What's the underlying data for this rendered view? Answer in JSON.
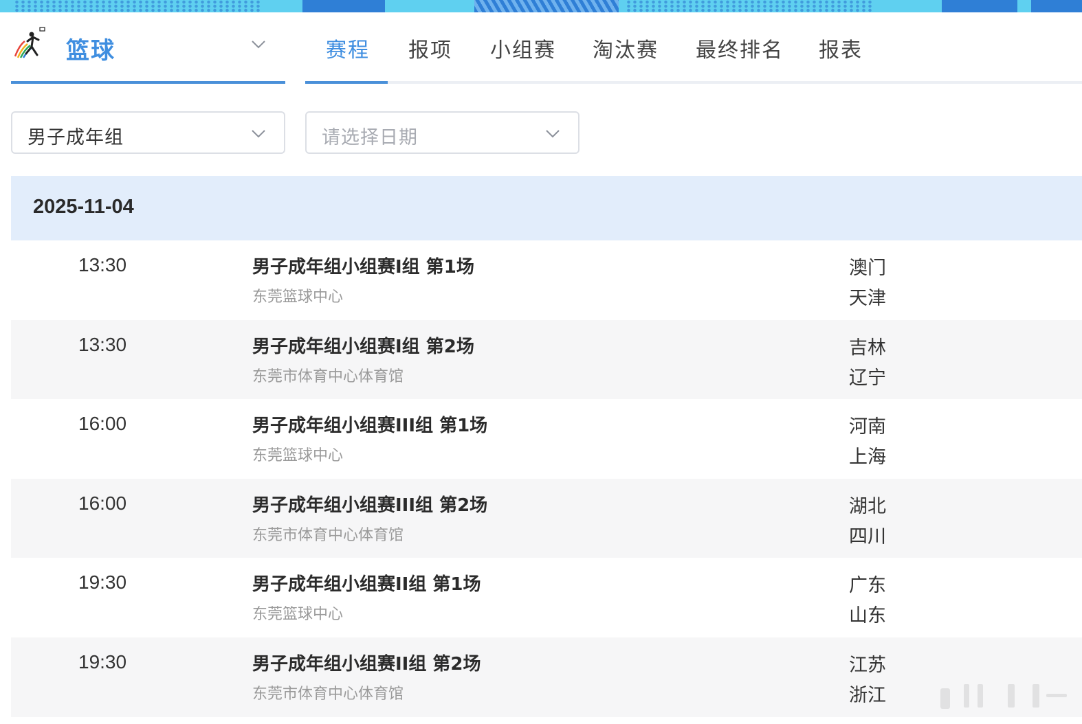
{
  "nav": {
    "sport_label": "篮球",
    "tabs": [
      {
        "label": "赛程",
        "active": true
      },
      {
        "label": "报项",
        "active": false
      },
      {
        "label": "小组赛",
        "active": false
      },
      {
        "label": "淘汰赛",
        "active": false
      },
      {
        "label": "最终排名",
        "active": false
      },
      {
        "label": "报表",
        "active": false
      }
    ]
  },
  "filters": {
    "group_value": "男子成年组",
    "date_placeholder": "请选择日期"
  },
  "schedule": {
    "date": "2025-11-04",
    "matches": [
      {
        "time": "13:30",
        "title": "男子成年组小组赛I组 第1场",
        "venue": "东莞篮球中心",
        "team1": "澳门",
        "team2": "天津"
      },
      {
        "time": "13:30",
        "title": "男子成年组小组赛I组 第2场",
        "venue": "东莞市体育中心体育馆",
        "team1": "吉林",
        "team2": "辽宁"
      },
      {
        "time": "16:00",
        "title": "男子成年组小组赛III组 第1场",
        "venue": "东莞篮球中心",
        "team1": "河南",
        "team2": "上海"
      },
      {
        "time": "16:00",
        "title": "男子成年组小组赛III组 第2场",
        "venue": "东莞市体育中心体育馆",
        "team1": "湖北",
        "team2": "四川"
      },
      {
        "time": "19:30",
        "title": "男子成年组小组赛II组 第1场",
        "venue": "东莞篮球中心",
        "team1": "广东",
        "team2": "山东"
      },
      {
        "time": "19:30",
        "title": "男子成年组小组赛II组 第2场",
        "venue": "东莞市体育中心体育馆",
        "team1": "江苏",
        "team2": "浙江"
      }
    ]
  },
  "colors": {
    "accent": "#3f8ee0",
    "date_header_bg": "#e2edfb",
    "alt_row_bg": "#f6f6f7"
  },
  "icons": {
    "sport_logo": "basketball-player-logo-icon",
    "dropdown": "chevron-down-icon"
  }
}
